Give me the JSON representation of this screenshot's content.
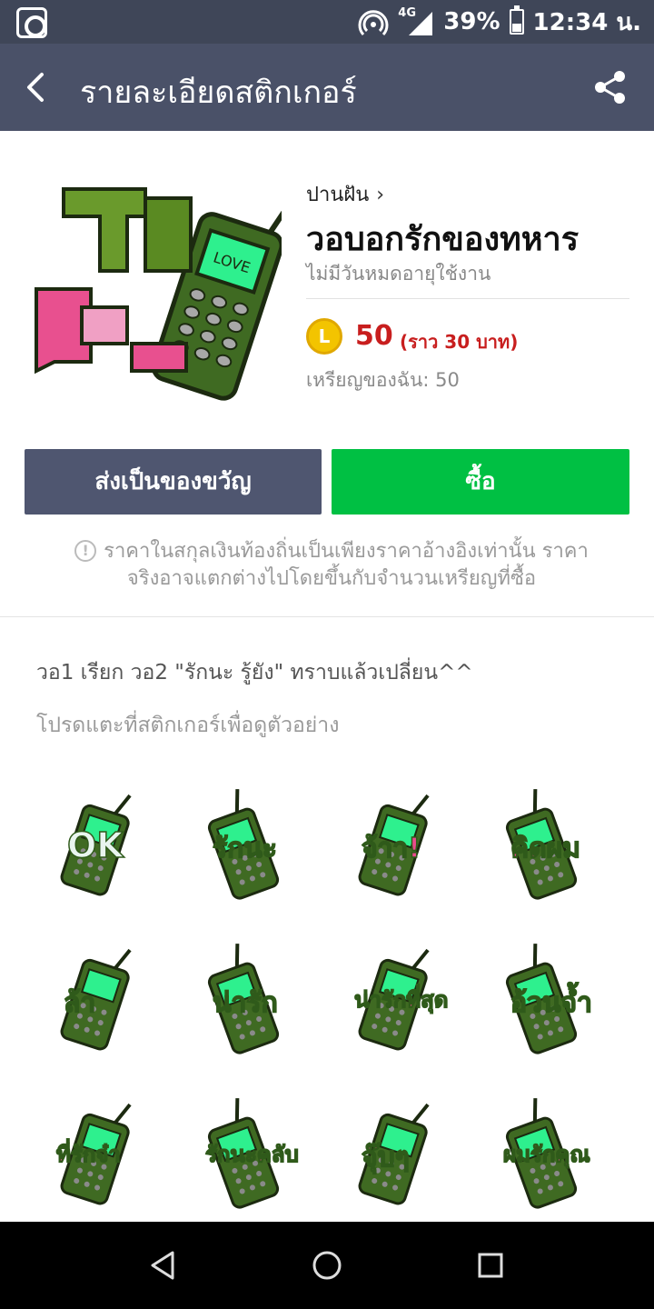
{
  "status_bar": {
    "network_label": "4G",
    "battery_pct": "39%",
    "time": "12:34 น.",
    "icons": [
      "app-notification-icon",
      "hotspot-icon",
      "signal-icon",
      "battery-icon"
    ]
  },
  "header": {
    "title": "รายละเอียดสติกเกอร์",
    "icons": [
      "back-arrow-icon",
      "share-icon"
    ]
  },
  "product": {
    "author": "ปานฝัน",
    "name": "วอบอกรักของทหาร",
    "validity": "ไม่มีวันหมดอายุใช้งาน",
    "coin_letter": "L",
    "price": "50",
    "price_approx": "(ราว 30 บาท)",
    "my_coins": "เหรียญของฉัน: 50",
    "thumbnail_text": "LOVE"
  },
  "buttons": {
    "gift_label": "ส่งเป็นของขวัญ",
    "buy_label": "ซื้อ"
  },
  "notice": {
    "icon_glyph": "!",
    "line1": "ราคาในสกุลเงินท้องถิ่นเป็นเพียงราคาอ้างอิงเท่านั้น ราคา",
    "line2": "จริงอาจแตกต่างไปโดยขึ้นกับจำนวนเหรียญที่ซื้อ"
  },
  "description": "วอ1 เรียก วอ2 \"รักนะ รู้ยัง\" ทราบแล้วเปลี่ยน^^",
  "hint": "โปรดแตะที่สติกเกอร์เพื่อดูตัวอย่าง",
  "stickers": [
    {
      "label": "OK"
    },
    {
      "label": "รักนะ"
    },
    {
      "label": "จ้าา!"
    },
    {
      "label": "คิดผม"
    },
    {
      "label": "ล้า"
    },
    {
      "label": "น่ารัก"
    },
    {
      "label": "น่ารักที่สุด"
    },
    {
      "label": "อ้วนจ้ำ"
    },
    {
      "label": "ที่รักจ๋า"
    },
    {
      "label": "รักนะคลับ"
    },
    {
      "label": "จุ๊บๆ"
    },
    {
      "label": "ผมรักคุณ"
    }
  ],
  "colors": {
    "header_bg": "#4a5168",
    "status_bg": "#3f4658",
    "buy_green": "#00c043",
    "gift_slate": "#4f5670",
    "price_red": "#c81e1e",
    "coin_yellow": "#f3c400"
  }
}
